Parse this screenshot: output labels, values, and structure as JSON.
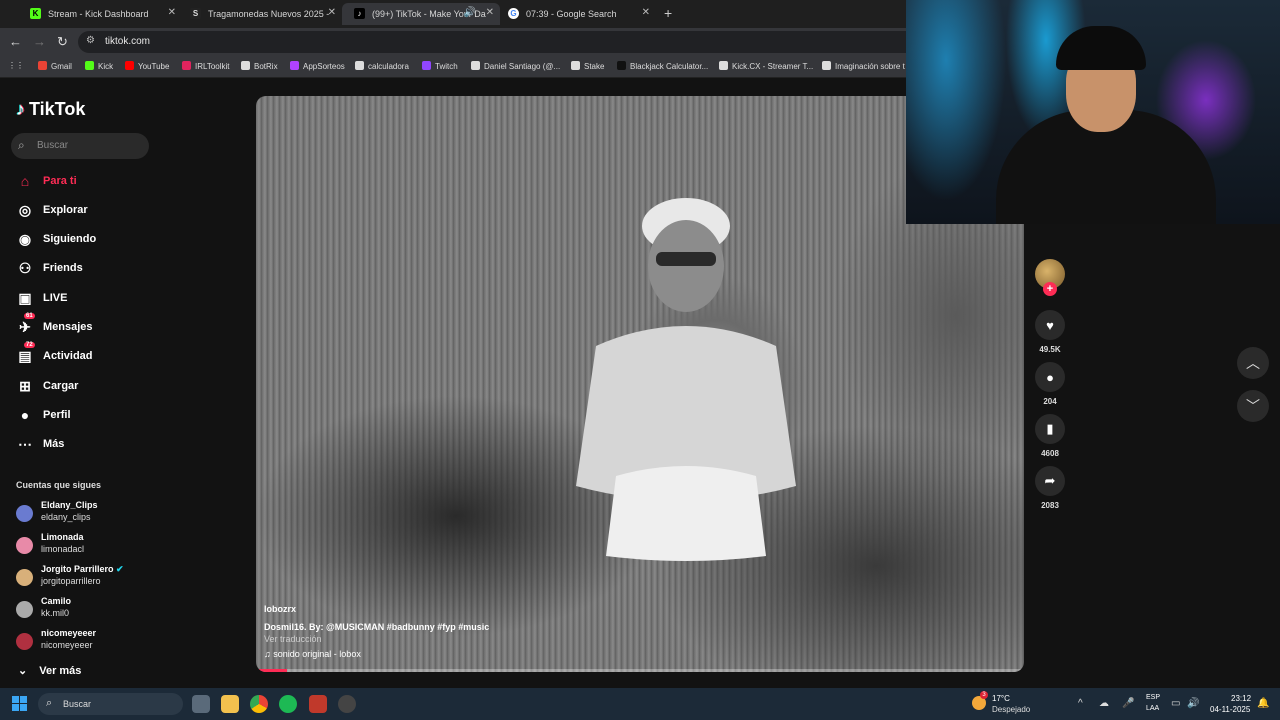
{
  "browser": {
    "tabs": [
      {
        "label": "Stream - Kick Dashboard",
        "favicon": "kick-icon",
        "color": "#53fc18"
      },
      {
        "label": "Tragamonedas Nuevos 2025 - ",
        "favicon": "stake-icon",
        "color": "#888888"
      },
      {
        "label": "(99+) TikTok - Make Your Da",
        "favicon": "tiktok-icon",
        "color": "#000000"
      },
      {
        "label": "07:39 - Google Search",
        "favicon": "google-icon",
        "color": "#4285f4"
      }
    ],
    "url": "tiktok.com",
    "bookmarks": [
      {
        "label": "Gmail",
        "color": "#ea4335"
      },
      {
        "label": "Kick",
        "color": "#53fc18"
      },
      {
        "label": "YouTube",
        "color": "#ff0000"
      },
      {
        "label": "IRLToolkit",
        "color": "#e0245e"
      },
      {
        "label": "BotRix",
        "color": "#dddddd"
      },
      {
        "label": "AppSorteos",
        "color": "#b042ff"
      },
      {
        "label": "calculadora",
        "color": "#dddddd"
      },
      {
        "label": "Twitch",
        "color": "#9146ff"
      },
      {
        "label": "Daniel Santiago (@...",
        "color": "#dddddd"
      },
      {
        "label": "Stake",
        "color": "#dddddd"
      },
      {
        "label": "Blackjack Calculator...",
        "color": "#111111"
      },
      {
        "label": "Kick.CX - Streamer T...",
        "color": "#dddddd"
      },
      {
        "label": "Imaginación sobre t",
        "color": "#dddddd"
      }
    ]
  },
  "tiktok": {
    "logo": "TikTok",
    "search_placeholder": "Buscar",
    "nav": [
      {
        "label": "Para ti",
        "icon": "home-icon",
        "active": true
      },
      {
        "label": "Explorar",
        "icon": "compass-icon"
      },
      {
        "label": "Siguiendo",
        "icon": "following-icon"
      },
      {
        "label": "Friends",
        "icon": "friends-icon"
      },
      {
        "label": "LIVE",
        "icon": "live-icon"
      },
      {
        "label": "Mensajes",
        "icon": "messages-icon",
        "badge": "61"
      },
      {
        "label": "Actividad",
        "icon": "activity-icon",
        "badge": "72"
      },
      {
        "label": "Cargar",
        "icon": "upload-icon"
      },
      {
        "label": "Perfil",
        "icon": "profile-icon"
      },
      {
        "label": "Más",
        "icon": "more-icon"
      }
    ],
    "following_title": "Cuentas que sigues",
    "following": [
      {
        "name": "Eldany_Clips",
        "handle": "eldany_clips",
        "color": "#6a7bd0"
      },
      {
        "name": "Limonada",
        "handle": "limonadacl",
        "color": "#e88aa8"
      },
      {
        "name": "Jorgito Parrillero",
        "handle": "jorgitoparrillero",
        "color": "#d8b07a",
        "verified": true
      },
      {
        "name": "Camilo",
        "handle": "kk.mil0",
        "color": "#aaaaaa"
      },
      {
        "name": "nicomeyeeer",
        "handle": "nicomeyeeer",
        "color": "#b03040"
      }
    ],
    "see_more": "Ver más",
    "video": {
      "username": "lobozrx",
      "description": "Dosmil16. By: @MUSICMAN  #badbunny  #fyp  #music",
      "translate": "Ver traducción",
      "sound": "sonido original - lobox",
      "progress": 0.04
    },
    "actions": {
      "likes": "49.5K",
      "comments": "204",
      "saves": "4608",
      "shares": "2083"
    }
  },
  "taskbar": {
    "search_placeholder": "Buscar",
    "weather_temp": "17°C",
    "weather_desc": "Despejado",
    "weather_badge": "3",
    "lang_top": "ESP",
    "lang_bottom": "LAA",
    "time": "23:12",
    "date": "04-11-2025"
  }
}
